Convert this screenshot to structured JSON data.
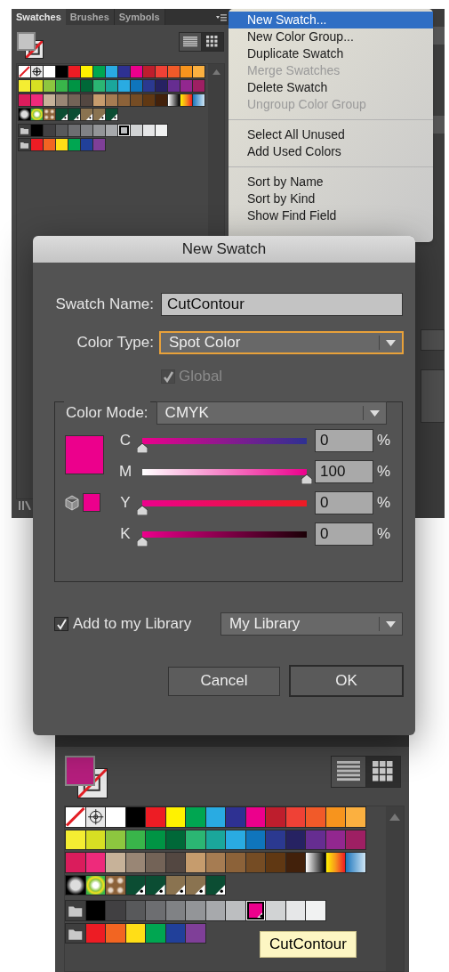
{
  "top_panel": {
    "tabs": [
      {
        "label": "Swatches",
        "selected": true
      },
      {
        "label": "Brushes",
        "selected": false
      },
      {
        "label": "Symbols",
        "selected": false
      }
    ],
    "fill_swatch": {
      "color": "#c4c4c4"
    },
    "view_buttons": [
      {
        "kind": "list",
        "selected": false
      },
      {
        "kind": "grid",
        "selected": true
      }
    ],
    "swatch_rows": [
      [
        {
          "kind": "none",
          "selected": false
        },
        {
          "kind": "registration",
          "selected": false
        },
        {
          "kind": "color",
          "color": "#ffffff",
          "selected": false
        },
        {
          "kind": "color",
          "color": "#000000",
          "selected": false
        },
        {
          "kind": "color",
          "color": "#ed1c24",
          "selected": false
        },
        {
          "kind": "color",
          "color": "#fff200",
          "selected": false
        },
        {
          "kind": "color",
          "color": "#00a651",
          "selected": false
        },
        {
          "kind": "color",
          "color": "#29abe2",
          "selected": false
        },
        {
          "kind": "color",
          "color": "#2e3192",
          "selected": false
        },
        {
          "kind": "color",
          "color": "#ec008c",
          "selected": false
        },
        {
          "kind": "color",
          "color": "#be1e2d",
          "selected": false
        },
        {
          "kind": "color",
          "color": "#ef4136",
          "selected": false
        },
        {
          "kind": "color",
          "color": "#f15a29",
          "selected": false
        },
        {
          "kind": "color",
          "color": "#f7941d",
          "selected": false
        },
        {
          "kind": "color",
          "color": "#fbb040",
          "selected": false
        }
      ],
      [
        {
          "kind": "color",
          "color": "#f4ed32",
          "selected": false
        },
        {
          "kind": "color",
          "color": "#d7df23",
          "selected": false
        },
        {
          "kind": "color",
          "color": "#8dc63f",
          "selected": false
        },
        {
          "kind": "color",
          "color": "#39b54a",
          "selected": false
        },
        {
          "kind": "color",
          "color": "#009444",
          "selected": false
        },
        {
          "kind": "color",
          "color": "#006838",
          "selected": false
        },
        {
          "kind": "color",
          "color": "#2bb673",
          "selected": false
        },
        {
          "kind": "color",
          "color": "#1aa79b",
          "selected": false
        },
        {
          "kind": "color",
          "color": "#29abe2",
          "selected": false
        },
        {
          "kind": "color",
          "color": "#0f75bc",
          "selected": false
        },
        {
          "kind": "color",
          "color": "#2b3990",
          "selected": false
        },
        {
          "kind": "color",
          "color": "#262262",
          "selected": false
        },
        {
          "kind": "color",
          "color": "#662d91",
          "selected": false
        },
        {
          "kind": "color",
          "color": "#92278f",
          "selected": false
        },
        {
          "kind": "color",
          "color": "#9e1f63",
          "selected": false
        }
      ],
      [
        {
          "kind": "color",
          "color": "#da1c5c",
          "selected": false
        },
        {
          "kind": "color",
          "color": "#ee2a7b",
          "selected": false
        },
        {
          "kind": "color",
          "color": "#c7b299",
          "selected": false
        },
        {
          "kind": "color",
          "color": "#998675",
          "selected": false
        },
        {
          "kind": "color",
          "color": "#736357",
          "selected": false
        },
        {
          "kind": "color",
          "color": "#534741",
          "selected": false
        },
        {
          "kind": "color",
          "color": "#c69c6d",
          "selected": false
        },
        {
          "kind": "color",
          "color": "#a67c52",
          "selected": false
        },
        {
          "kind": "color",
          "color": "#8c6239",
          "selected": false
        },
        {
          "kind": "color",
          "color": "#754c24",
          "selected": false
        },
        {
          "kind": "color",
          "color": "#603813",
          "selected": false
        },
        {
          "kind": "color",
          "color": "#42210b",
          "selected": false
        },
        {
          "kind": "gradient_gray",
          "selected": false
        },
        {
          "kind": "gradient_warm",
          "selected": false
        },
        {
          "kind": "gradient_fade",
          "selected": false
        }
      ],
      [
        {
          "kind": "pattern_dots",
          "selected": false
        },
        {
          "kind": "pattern_leaves",
          "selected": false
        },
        {
          "kind": "pattern_swirl",
          "selected": false
        },
        {
          "kind": "global",
          "color": "#0b4d33",
          "selected": false
        },
        {
          "kind": "global",
          "color": "#0b4d33",
          "selected": false
        },
        {
          "kind": "global",
          "color": "#8a7350",
          "selected": false
        },
        {
          "kind": "global",
          "color": "#8a7350",
          "selected": false
        },
        {
          "kind": "global",
          "color": "#0b4d33",
          "selected": false
        }
      ],
      [
        {
          "kind": "folder",
          "selected": false
        },
        {
          "kind": "color",
          "color": "#000000",
          "selected": false
        },
        {
          "kind": "color",
          "color": "#414042",
          "selected": false
        },
        {
          "kind": "color",
          "color": "#58595b",
          "selected": false
        },
        {
          "kind": "color",
          "color": "#6d6e71",
          "selected": false
        },
        {
          "kind": "color",
          "color": "#808285",
          "selected": false
        },
        {
          "kind": "color",
          "color": "#939598",
          "selected": false
        },
        {
          "kind": "color",
          "color": "#a7a9ac",
          "selected": false
        },
        {
          "kind": "color",
          "color": "#bcbec0",
          "selected": true
        },
        {
          "kind": "color",
          "color": "#d1d3d4",
          "selected": false
        },
        {
          "kind": "color",
          "color": "#e6e7e8",
          "selected": false
        },
        {
          "kind": "color",
          "color": "#f1f2f2",
          "selected": false
        }
      ],
      [
        {
          "kind": "folder",
          "selected": false
        },
        {
          "kind": "color",
          "color": "#ed1c24",
          "selected": false
        },
        {
          "kind": "color",
          "color": "#f26522",
          "selected": false
        },
        {
          "kind": "color",
          "color": "#ffde17",
          "selected": false
        },
        {
          "kind": "color",
          "color": "#00a651",
          "selected": false
        },
        {
          "kind": "color",
          "color": "#21409a",
          "selected": false
        },
        {
          "kind": "color",
          "color": "#7f3f98",
          "selected": false
        }
      ]
    ]
  },
  "panel_menu": {
    "groups": [
      [
        {
          "label": "New Swatch...",
          "selected": true,
          "disabled": false
        },
        {
          "label": "New Color Group...",
          "selected": false,
          "disabled": false
        },
        {
          "label": "Duplicate Swatch",
          "selected": false,
          "disabled": false
        },
        {
          "label": "Merge Swatches",
          "selected": false,
          "disabled": true
        },
        {
          "label": "Delete Swatch",
          "selected": false,
          "disabled": false
        },
        {
          "label": "Ungroup Color Group",
          "selected": false,
          "disabled": true
        }
      ],
      [
        {
          "label": "Select All Unused",
          "selected": false,
          "disabled": false
        },
        {
          "label": "Add Used Colors",
          "selected": false,
          "disabled": false
        }
      ],
      [
        {
          "label": "Sort by Name",
          "selected": false,
          "disabled": false
        },
        {
          "label": "Sort by Kind",
          "selected": false,
          "disabled": false
        },
        {
          "label": "Show Find Field",
          "selected": false,
          "disabled": false
        }
      ]
    ]
  },
  "dialog": {
    "title": "New Swatch",
    "swatch_name": {
      "label": "Swatch Name:",
      "value": "CutContour"
    },
    "color_type": {
      "label": "Color Type:",
      "value": "Spot Color"
    },
    "global": {
      "label": "Global",
      "checked": true,
      "disabled": true
    },
    "color_mode": {
      "label": "Color Mode:",
      "value": "CMYK"
    },
    "preview": {
      "color": "#ec008c"
    },
    "channels": [
      {
        "name": "C",
        "level": 0,
        "value": "0",
        "unit": "%"
      },
      {
        "name": "M",
        "level": 1,
        "value": "100",
        "unit": "%"
      },
      {
        "name": "Y",
        "level": 0,
        "value": "0",
        "unit": "%"
      },
      {
        "name": "K",
        "level": 0,
        "value": "0",
        "unit": "%"
      }
    ],
    "library": {
      "label": "Add to my Library",
      "checked": true,
      "value": "My Library"
    },
    "buttons": [
      {
        "label": "Cancel",
        "kind": "secondary"
      },
      {
        "label": "OK",
        "kind": "default"
      }
    ]
  },
  "bottom_panel": {
    "fill_swatch": {
      "color": "#b51e7d"
    },
    "view_buttons": [
      {
        "kind": "list",
        "selected": false
      },
      {
        "kind": "grid",
        "selected": true
      }
    ],
    "swatch_rows": [
      [
        {
          "kind": "none",
          "selected": false
        },
        {
          "kind": "registration",
          "selected": false
        },
        {
          "kind": "color",
          "color": "#ffffff",
          "selected": false
        },
        {
          "kind": "color",
          "color": "#000000",
          "selected": false
        },
        {
          "kind": "color",
          "color": "#ed1c24",
          "selected": false
        },
        {
          "kind": "color",
          "color": "#fff200",
          "selected": false
        },
        {
          "kind": "color",
          "color": "#00a651",
          "selected": false
        },
        {
          "kind": "color",
          "color": "#29abe2",
          "selected": false
        },
        {
          "kind": "color",
          "color": "#2e3192",
          "selected": false
        },
        {
          "kind": "color",
          "color": "#ec008c",
          "selected": false
        },
        {
          "kind": "color",
          "color": "#be1e2d",
          "selected": false
        },
        {
          "kind": "color",
          "color": "#ef4136",
          "selected": false
        },
        {
          "kind": "color",
          "color": "#f15a29",
          "selected": false
        },
        {
          "kind": "color",
          "color": "#f7941d",
          "selected": false
        },
        {
          "kind": "color",
          "color": "#fbb040",
          "selected": false
        }
      ],
      [
        {
          "kind": "color",
          "color": "#f4ed32",
          "selected": false
        },
        {
          "kind": "color",
          "color": "#d7df23",
          "selected": false
        },
        {
          "kind": "color",
          "color": "#8dc63f",
          "selected": false
        },
        {
          "kind": "color",
          "color": "#39b54a",
          "selected": false
        },
        {
          "kind": "color",
          "color": "#009444",
          "selected": false
        },
        {
          "kind": "color",
          "color": "#006838",
          "selected": false
        },
        {
          "kind": "color",
          "color": "#2bb673",
          "selected": false
        },
        {
          "kind": "color",
          "color": "#1aa79b",
          "selected": false
        },
        {
          "kind": "color",
          "color": "#29abe2",
          "selected": false
        },
        {
          "kind": "color",
          "color": "#0f75bc",
          "selected": false
        },
        {
          "kind": "color",
          "color": "#2b3990",
          "selected": false
        },
        {
          "kind": "color",
          "color": "#262262",
          "selected": false
        },
        {
          "kind": "color",
          "color": "#662d91",
          "selected": false
        },
        {
          "kind": "color",
          "color": "#92278f",
          "selected": false
        },
        {
          "kind": "color",
          "color": "#9e1f63",
          "selected": false
        }
      ],
      [
        {
          "kind": "color",
          "color": "#da1c5c",
          "selected": false
        },
        {
          "kind": "color",
          "color": "#ee2a7b",
          "selected": false
        },
        {
          "kind": "color",
          "color": "#c7b299",
          "selected": false
        },
        {
          "kind": "color",
          "color": "#998675",
          "selected": false
        },
        {
          "kind": "color",
          "color": "#736357",
          "selected": false
        },
        {
          "kind": "color",
          "color": "#534741",
          "selected": false
        },
        {
          "kind": "color",
          "color": "#c69c6d",
          "selected": false
        },
        {
          "kind": "color",
          "color": "#a67c52",
          "selected": false
        },
        {
          "kind": "color",
          "color": "#8c6239",
          "selected": false
        },
        {
          "kind": "color",
          "color": "#754c24",
          "selected": false
        },
        {
          "kind": "color",
          "color": "#603813",
          "selected": false
        },
        {
          "kind": "color",
          "color": "#42210b",
          "selected": false
        },
        {
          "kind": "gradient_gray",
          "selected": false
        },
        {
          "kind": "gradient_warm",
          "selected": false
        },
        {
          "kind": "gradient_fade",
          "selected": false
        }
      ],
      [
        {
          "kind": "pattern_dots",
          "selected": false
        },
        {
          "kind": "pattern_leaves",
          "selected": false
        },
        {
          "kind": "pattern_swirl",
          "selected": false
        },
        {
          "kind": "global",
          "color": "#0b4d33",
          "selected": false
        },
        {
          "kind": "global",
          "color": "#0b4d33",
          "selected": false
        },
        {
          "kind": "global",
          "color": "#8a7350",
          "selected": false
        },
        {
          "kind": "global",
          "color": "#8a7350",
          "selected": false
        },
        {
          "kind": "global",
          "color": "#0b4d33",
          "selected": false
        }
      ],
      [
        {
          "kind": "folder",
          "selected": false
        },
        {
          "kind": "color",
          "color": "#000000",
          "selected": false
        },
        {
          "kind": "color",
          "color": "#414042",
          "selected": false
        },
        {
          "kind": "color",
          "color": "#58595b",
          "selected": false
        },
        {
          "kind": "color",
          "color": "#6d6e71",
          "selected": false
        },
        {
          "kind": "color",
          "color": "#808285",
          "selected": false
        },
        {
          "kind": "color",
          "color": "#939598",
          "selected": false
        },
        {
          "kind": "color",
          "color": "#a7a9ac",
          "selected": false
        },
        {
          "kind": "color",
          "color": "#bcbec0",
          "selected": false
        },
        {
          "kind": "spot",
          "color": "#ec008c",
          "selected": true
        },
        {
          "kind": "color",
          "color": "#d1d3d4",
          "selected": false
        },
        {
          "kind": "color",
          "color": "#e6e7e8",
          "selected": false
        },
        {
          "kind": "color",
          "color": "#f1f2f2",
          "selected": false
        }
      ],
      [
        {
          "kind": "folder",
          "selected": false
        },
        {
          "kind": "color",
          "color": "#ed1c24",
          "selected": false
        },
        {
          "kind": "color",
          "color": "#f26522",
          "selected": false
        },
        {
          "kind": "color",
          "color": "#ffde17",
          "selected": false
        },
        {
          "kind": "color",
          "color": "#00a651",
          "selected": false
        },
        {
          "kind": "color",
          "color": "#21409a",
          "selected": false
        },
        {
          "kind": "color",
          "color": "#7f3f98",
          "selected": false
        }
      ]
    ],
    "tooltip": "CutContour"
  }
}
